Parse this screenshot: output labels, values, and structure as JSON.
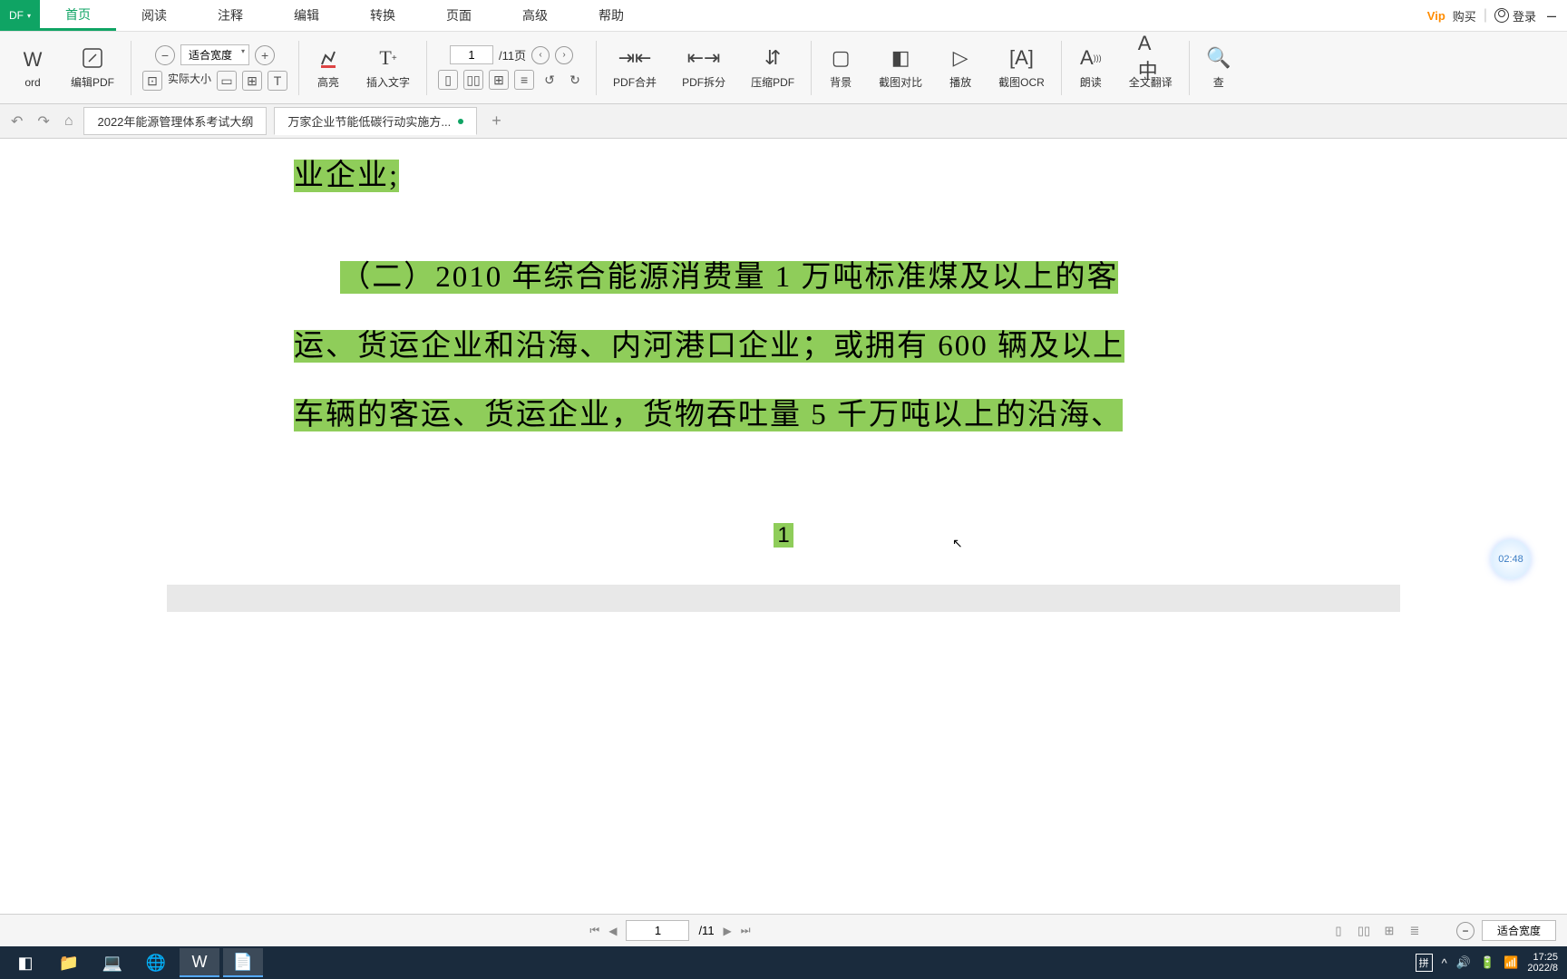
{
  "app": {
    "logo": "DF"
  },
  "menu": {
    "home": "首页",
    "read": "阅读",
    "annot": "注释",
    "edit": "编辑",
    "convert": "转换",
    "page": "页面",
    "advanced": "高级",
    "help": "帮助"
  },
  "top_right": {
    "vip": "Vip",
    "buy": "购买",
    "login": "登录",
    "min": "–"
  },
  "ribbon": {
    "word": "ord",
    "editpdf": "编辑PDF",
    "fitwidth": "适合宽度",
    "actual": "实际大小",
    "highlight": "高亮",
    "insert_text": "插入文字",
    "page_current": "1",
    "page_total": "/11页",
    "merge": "PDF合并",
    "split": "PDF拆分",
    "compress": "压缩PDF",
    "bg": "背景",
    "compare": "截图对比",
    "play": "播放",
    "ocr": "截图OCR",
    "read": "朗读",
    "translate": "全文翻译",
    "search": "查"
  },
  "tabs": {
    "t1": "2022年能源管理体系考试大纲",
    "t2": "万家企业节能低碳行动实施方..."
  },
  "doc": {
    "frag0": "业企业;",
    "line1": "（二）2010 年综合能源消费量 1 万吨标准煤及以上的客",
    "line2": "运、货运企业和沿海、内河港口企业；或拥有 600 辆及以上",
    "line3": "车辆的客运、货运企业，货物吞吐量 5 千万吨以上的沿海、",
    "pagenum": "1"
  },
  "timer": "02:48",
  "status": {
    "page": "1",
    "total": "/11",
    "fit": "适合宽度"
  },
  "taskbar": {
    "ime": "拼",
    "time": "17:25",
    "date": "2022/8"
  }
}
